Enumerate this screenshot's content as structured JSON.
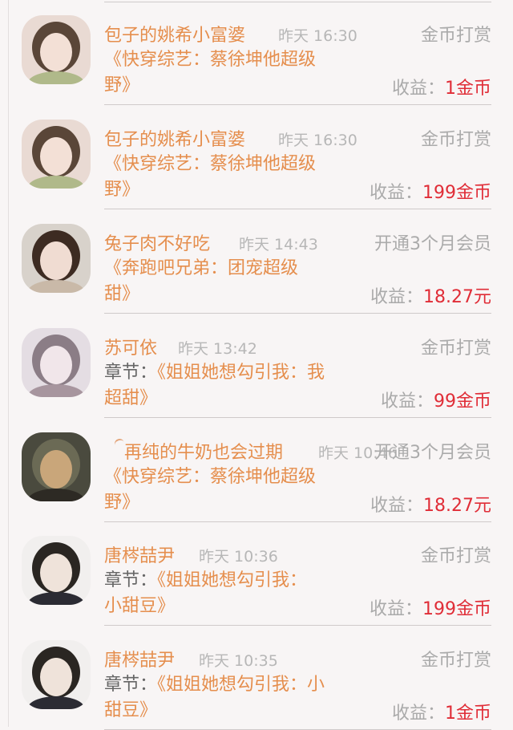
{
  "rows": [
    {
      "name": "包子的姚希小富婆",
      "time": "昨天 16:30",
      "action": "金币打赏",
      "prefix": "",
      "title_line1": "《快穿综艺：蔡徐坤他超级",
      "title_line2": "野》",
      "income_label": "收益：",
      "income_value": "1金币",
      "avatar": {
        "bg": "#e9dad3",
        "hair": "#5a4638",
        "face": "#f3e0d6",
        "accent": "#b0b98a"
      }
    },
    {
      "name": "包子的姚希小富婆",
      "time": "昨天 16:30",
      "action": "金币打赏",
      "prefix": "",
      "title_line1": "《快穿综艺：蔡徐坤他超级",
      "title_line2": "野》",
      "income_label": "收益：",
      "income_value": "199金币",
      "avatar": {
        "bg": "#e9dad3",
        "hair": "#5a4638",
        "face": "#f3e0d6",
        "accent": "#b0b98a"
      }
    },
    {
      "name": "兔子肉不好吃",
      "time": "昨天 14:43",
      "action": "开通3个月会员",
      "prefix": "",
      "title_line1": "《奔跑吧兄弟：团宠超级",
      "title_line2": "甜》",
      "income_label": "收益：",
      "income_value": "18.27元",
      "avatar": {
        "bg": "#d8d2cb",
        "hair": "#3d2b22",
        "face": "#f0dcd2",
        "accent": "#c9b9a8"
      }
    },
    {
      "name": "苏可依",
      "time": "昨天 13:42",
      "action": "金币打赏",
      "prefix": "章节：",
      "title_line1": "《姐姐她想勾引我：我",
      "title_line2": "超甜》",
      "income_label": "收益：",
      "income_value": "99金币",
      "avatar": {
        "bg": "#e4dde3",
        "hair": "#8b7d86",
        "face": "#f1e6ea",
        "accent": "#a7959e"
      }
    },
    {
      "name": "再纯的牛奶也会过期",
      "time": "昨天 10:46",
      "action": "开通3个月会员",
      "prefix": "",
      "title_line1": "《快穿综艺：蔡徐坤他超级",
      "title_line2": "野》",
      "income_label": "收益：",
      "income_value": "18.27元",
      "avatar": {
        "bg": "#4a4a3e",
        "hair": "#6b6a55",
        "face": "#c9a67a",
        "accent": "#2d2a24"
      }
    },
    {
      "name": "唐梣喆尹",
      "time": "昨天 10:36",
      "action": "金币打赏",
      "prefix": "章节：",
      "title_line1": "《姐姐她想勾引我：",
      "title_line2": "小甜豆》",
      "income_label": "收益：",
      "income_value": "199金币",
      "avatar": {
        "bg": "#f1efee",
        "hair": "#2a2622",
        "face": "#efe3da",
        "accent": "#2b2b33"
      }
    },
    {
      "name": "唐梣喆尹",
      "time": "昨天 10:35",
      "action": "金币打赏",
      "prefix": "章节：",
      "title_line1": "《姐姐她想勾引我：小",
      "title_line2": "甜豆》",
      "income_label": "收益：",
      "income_value": "1金币",
      "avatar": {
        "bg": "#f1efee",
        "hair": "#2a2622",
        "face": "#efe3da",
        "accent": "#2b2b33"
      }
    }
  ]
}
